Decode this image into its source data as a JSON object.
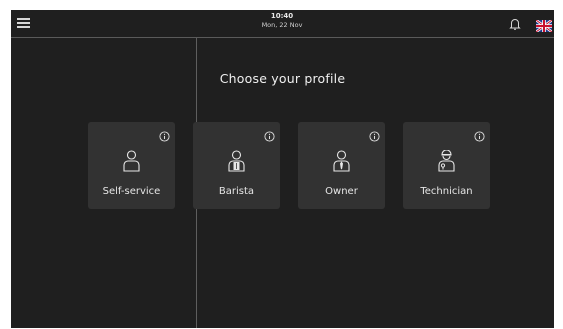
{
  "colors": {
    "background": "#1f1f1f",
    "card": "#323232",
    "text": "#f0f0f0",
    "divider": "#5e5e5e"
  },
  "header": {
    "time": "10:40",
    "date": "Mon, 22 Nov",
    "menu_icon": "hamburger-menu-icon",
    "notification_icon": "bell-icon",
    "language_icon": "uk-flag-icon"
  },
  "main": {
    "title": "Choose your profile",
    "profiles": [
      {
        "label": "Self-service",
        "icon": "person-icon"
      },
      {
        "label": "Barista",
        "icon": "barista-icon"
      },
      {
        "label": "Owner",
        "icon": "owner-icon"
      },
      {
        "label": "Technician",
        "icon": "technician-icon"
      }
    ]
  }
}
